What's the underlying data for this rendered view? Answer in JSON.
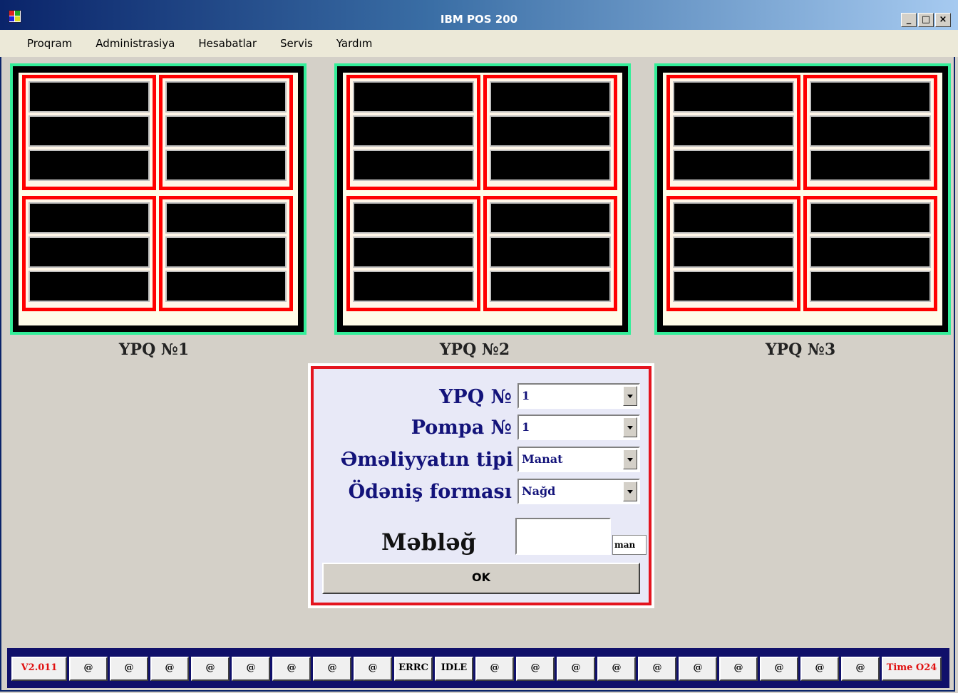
{
  "window": {
    "title": "IBM POS 200",
    "min_glyph": "_",
    "max_glyph": "□",
    "close_glyph": "×"
  },
  "menu": [
    {
      "label": "Proqram"
    },
    {
      "label": "Administrasiya"
    },
    {
      "label": "Hesabatlar"
    },
    {
      "label": "Servis"
    },
    {
      "label": "Yardım"
    }
  ],
  "pumps": [
    {
      "caption": "YPQ №1"
    },
    {
      "caption": "YPQ №2"
    },
    {
      "caption": "YPQ №3"
    }
  ],
  "form": {
    "ypq_label": "YPQ №",
    "ypq_value": "1",
    "pompa_label": "Pompa №",
    "pompa_value": "1",
    "op_type_label": "Əməliyyatın tipi",
    "op_type_value": "Manat",
    "payment_label": "Ödəniş forması",
    "payment_value": "Nağd",
    "amount_label": "Məbləğ",
    "amount_value": "",
    "unit": "man",
    "ok_label": "OK"
  },
  "status": [
    {
      "text": "V2.011",
      "red": true
    },
    {
      "text": "@"
    },
    {
      "text": "@"
    },
    {
      "text": "@"
    },
    {
      "text": "@"
    },
    {
      "text": "@"
    },
    {
      "text": "@"
    },
    {
      "text": "@"
    },
    {
      "text": "@"
    },
    {
      "text": "ERRC"
    },
    {
      "text": "IDLE"
    },
    {
      "text": "@"
    },
    {
      "text": "@"
    },
    {
      "text": "@"
    },
    {
      "text": "@"
    },
    {
      "text": "@"
    },
    {
      "text": "@"
    },
    {
      "text": "@"
    },
    {
      "text": "@"
    },
    {
      "text": "@"
    },
    {
      "text": "@"
    },
    {
      "text": "Time O24",
      "red": true
    }
  ],
  "colors": {
    "panel_border": "#33ee99",
    "nozzle_border": "#ff0000",
    "form_border": "#e4141e",
    "label_text": "#13137a"
  }
}
